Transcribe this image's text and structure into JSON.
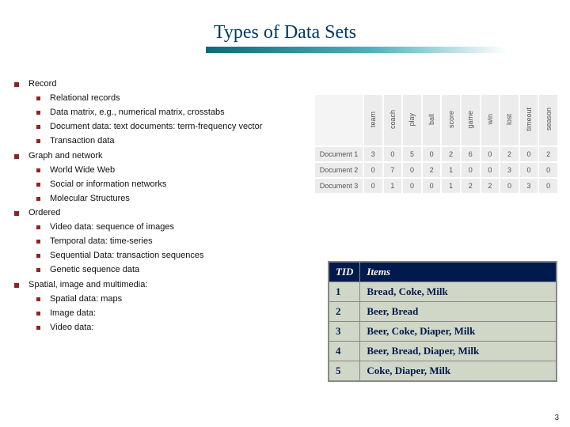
{
  "title": "Types of Data Sets",
  "page_number": "3",
  "outline": {
    "record": {
      "label": "Record",
      "items": [
        "Relational records",
        "Data matrix, e.g., numerical matrix, crosstabs",
        "Document data: text documents: term-frequency vector",
        "Transaction data"
      ]
    },
    "graph": {
      "label": "Graph and network",
      "items": [
        "World Wide Web",
        "Social or information networks",
        "Molecular Structures"
      ]
    },
    "ordered": {
      "label": "Ordered",
      "items": [
        "Video data: sequence of images",
        "Temporal data: time-series",
        "Sequential Data: transaction sequences",
        "Genetic sequence data"
      ]
    },
    "spatial": {
      "label": "Spatial, image and multimedia:",
      "items": [
        "Spatial data: maps",
        "Image data:",
        "Video data:"
      ]
    }
  },
  "doc_table": {
    "columns": [
      "team",
      "coach",
      "play",
      "ball",
      "score",
      "game",
      "win",
      "lost",
      "timeout",
      "season"
    ],
    "rows": [
      {
        "name": "Document 1",
        "vals": [
          "3",
          "0",
          "5",
          "0",
          "2",
          "6",
          "0",
          "2",
          "0",
          "2"
        ]
      },
      {
        "name": "Document 2",
        "vals": [
          "0",
          "7",
          "0",
          "2",
          "1",
          "0",
          "0",
          "3",
          "0",
          "0"
        ]
      },
      {
        "name": "Document 3",
        "vals": [
          "0",
          "1",
          "0",
          "0",
          "1",
          "2",
          "2",
          "0",
          "3",
          "0"
        ]
      }
    ]
  },
  "tx_table": {
    "headers": {
      "tid": "TID",
      "items": "Items"
    },
    "rows": [
      {
        "tid": "1",
        "items": "Bread, Coke, Milk"
      },
      {
        "tid": "2",
        "items": "Beer, Bread"
      },
      {
        "tid": "3",
        "items": "Beer, Coke, Diaper, Milk"
      },
      {
        "tid": "4",
        "items": "Beer, Bread, Diaper, Milk"
      },
      {
        "tid": "5",
        "items": "Coke, Diaper, Milk"
      }
    ]
  }
}
